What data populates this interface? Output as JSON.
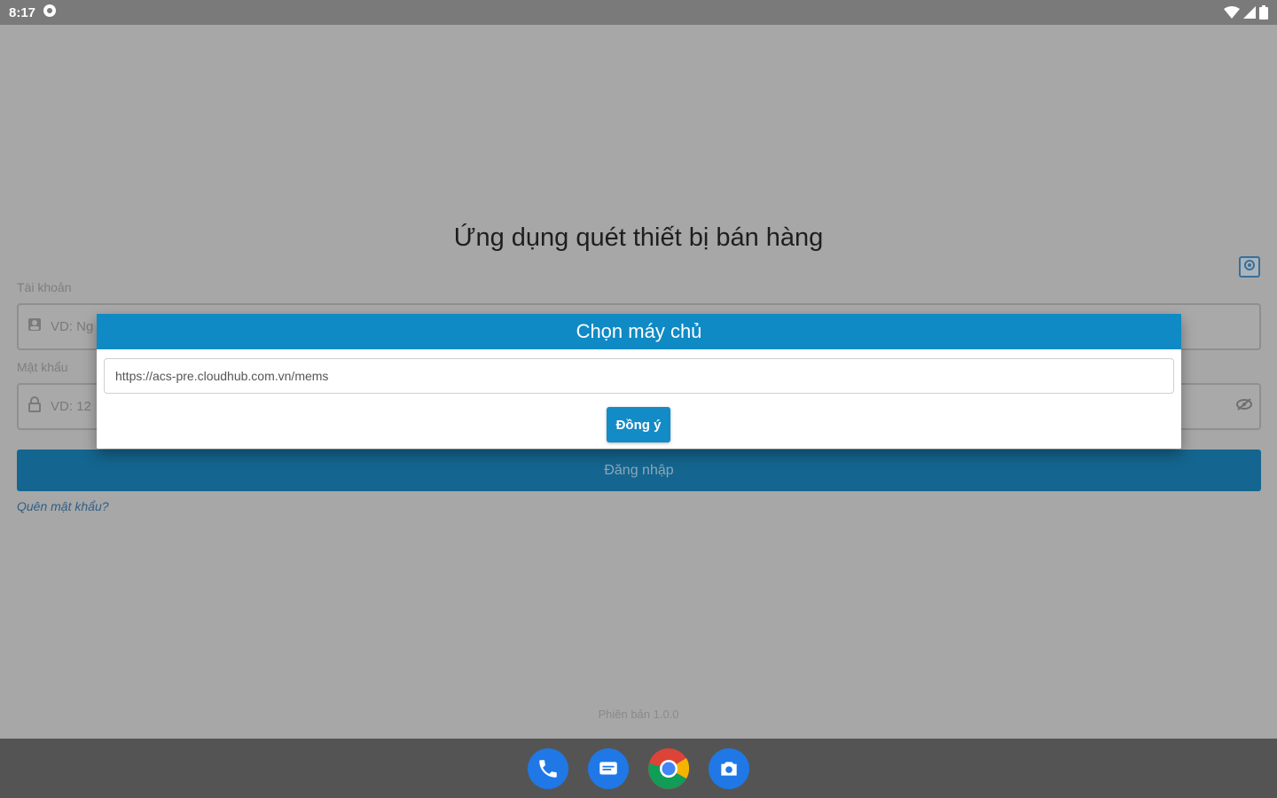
{
  "status_bar": {
    "time": "8:17"
  },
  "app": {
    "title": "Ứng dụng quét thiết bị bán hàng",
    "account": {
      "label": "Tài khoản",
      "placeholder": "VD: Ng"
    },
    "password": {
      "label": "Mật khẩu",
      "placeholder": "VD: 12"
    },
    "login_label": "Đăng nhập",
    "forgot_label": "Quên mật khẩu?",
    "version": "Phiên bản 1.0.0"
  },
  "dialog": {
    "title": "Chọn máy chủ",
    "server_value": "https://acs-pre.cloudhub.com.vn/mems",
    "ok_label": "Đồng ý"
  },
  "dock": {
    "icons": [
      "phone-icon",
      "messages-icon",
      "chrome-icon",
      "camera-icon"
    ]
  },
  "colors": {
    "dialog_header": "#0f8ac5",
    "login_button": "#14658f",
    "accent": "#138bc7"
  }
}
